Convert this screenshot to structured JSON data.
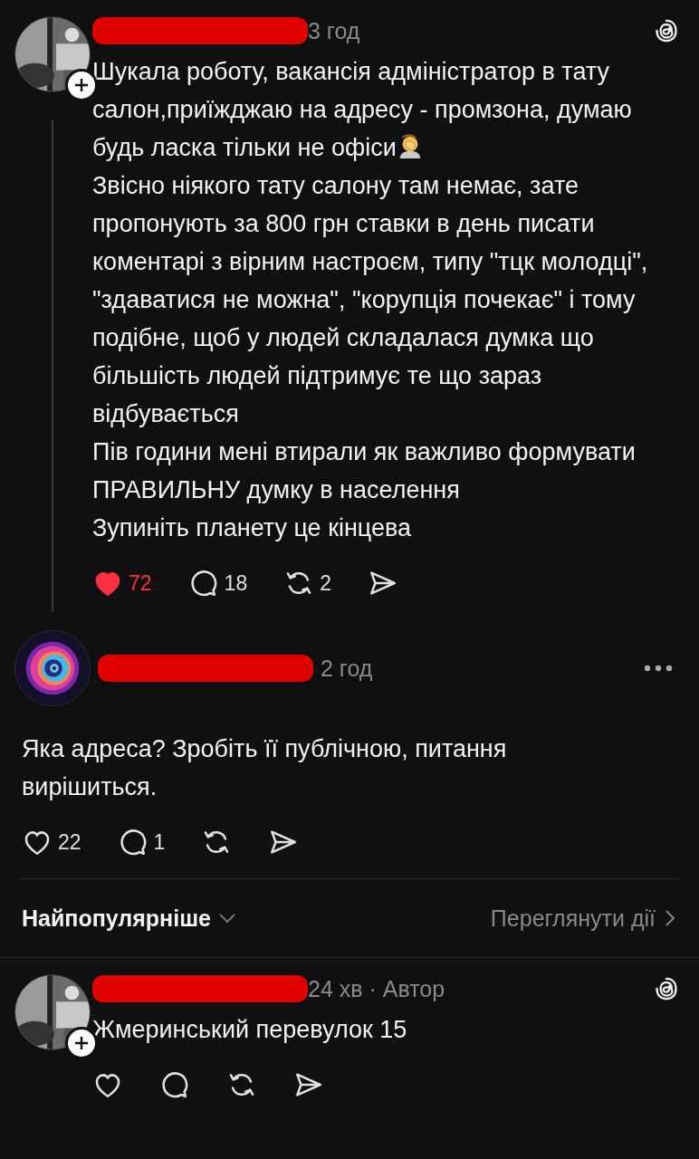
{
  "thread": [
    {
      "kind": "author",
      "time": "3 год",
      "thread_line": true,
      "paragraphs": [
        {
          "text": "Шукала роботу, вакансія адміністратор в тату салон,приїжджаю на адресу - промзона, думаю будь ласка тільки не офіси",
          "emoji": true
        },
        {
          "text": "Звісно ніякого тату салону там немає, зате пропонують за 800 грн ставки в день писати коментарі з вірним настроєм, типу \"тцк молодці\", \"здаватися не можна\", \"корупція почекає\" і тому подібне, щоб у людей складалася думка що більшість людей підтримує те що зараз відбувається",
          "emoji": false
        },
        {
          "text": "Пів години мені втирали як важливо формувати ПРАВИЛЬНУ думку в населення",
          "emoji": false
        },
        {
          "text": "Зупиніть планету це кінцева",
          "emoji": false
        }
      ],
      "actions": {
        "liked": true,
        "likes": "72",
        "replies": "18",
        "reposts": "2"
      }
    },
    {
      "kind": "reply",
      "time": "2 год",
      "paragraphs": [
        {
          "text": "Яка адреса? Зробіть її публічною, питання вирішиться.",
          "emoji": false
        }
      ],
      "actions": {
        "liked": false,
        "likes": "22",
        "replies": "1"
      }
    }
  ],
  "sort_bar": {
    "label": "Найпопулярніше",
    "link": "Переглянути дії"
  },
  "replies": [
    {
      "kind": "author",
      "time": "24 хв · Автор",
      "thread_line": false,
      "paragraphs": [
        {
          "text": "Жмеринський перевулок 15",
          "emoji": false
        }
      ],
      "actions": {
        "liked": false
      }
    }
  ]
}
